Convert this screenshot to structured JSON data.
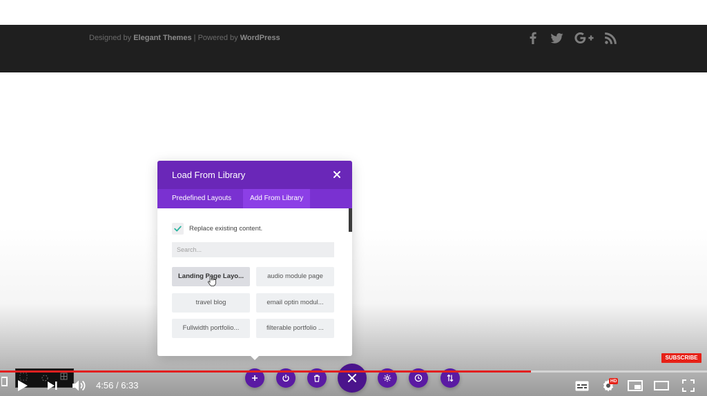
{
  "footer": {
    "designed_by": "Designed by",
    "elegant_themes": "Elegant Themes",
    "separator": "|",
    "powered_by": "Powered by",
    "wordpress": "WordPress",
    "social_icons": [
      "facebook-icon",
      "twitter-icon",
      "google-plus-icon",
      "rss-icon"
    ]
  },
  "modal": {
    "title": "Load From Library",
    "tabs": [
      {
        "label": "Predefined Layouts",
        "active": false
      },
      {
        "label": "Add From Library",
        "active": true
      }
    ],
    "replace_label": "Replace existing content.",
    "replace_checked": true,
    "search_placeholder": "Search...",
    "layouts": [
      {
        "label": "Landing Page Layo...",
        "active": true
      },
      {
        "label": "audio module page",
        "active": false
      },
      {
        "label": "travel blog",
        "active": false
      },
      {
        "label": "email optin modul...",
        "active": false
      },
      {
        "label": "Fullwidth portfolio...",
        "active": false
      },
      {
        "label": "filterable portfolio ...",
        "active": false
      }
    ]
  },
  "builder_bar": {
    "buttons": [
      "add-icon",
      "power-icon",
      "trash-icon",
      "close-icon",
      "gear-icon",
      "history-icon",
      "portability-icon"
    ]
  },
  "player": {
    "current_time": "4:56",
    "time_separator": "/",
    "duration": "6:33",
    "progress_fraction": 0.751,
    "subscribe_label": "SUBSCRIBE",
    "hd_label": "HD"
  },
  "colors": {
    "divi_purple": "#6a27b8",
    "tab_bar": "#7a31d1",
    "youtube_red": "#e62117"
  }
}
